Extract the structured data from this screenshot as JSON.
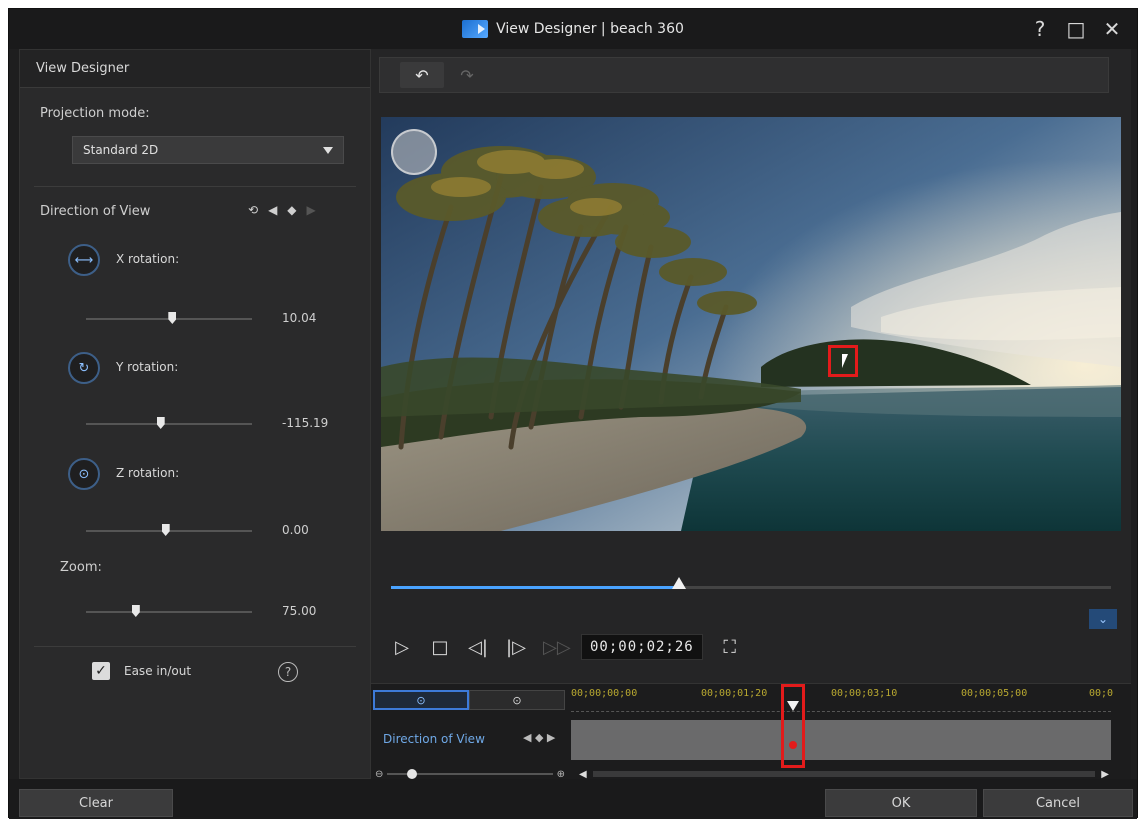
{
  "window": {
    "title": "View Designer | beach 360",
    "help": "?",
    "maximize": "□",
    "close": "✕"
  },
  "left_panel": {
    "header": "View Designer",
    "projection_label": "Projection mode:",
    "projection_value": "Standard 2D",
    "direction_label": "Direction of View",
    "x_rotation": {
      "label": "X rotation:",
      "value": "10.04",
      "level": 0.52
    },
    "y_rotation": {
      "label": "Y rotation:",
      "value": "-115.19",
      "level": 0.45
    },
    "z_rotation": {
      "label": "Z rotation:",
      "value": "0.00",
      "level": 0.48
    },
    "zoom": {
      "label": "Zoom:",
      "value": "75.00",
      "level": 0.3
    },
    "ease_label": "Ease in/out",
    "ease_checked": true
  },
  "toolbar": {
    "undo": "↶",
    "redo": "↷"
  },
  "playback": {
    "timecode": "00;00;02;26",
    "progress": 0.4
  },
  "timeline": {
    "track_label": "Direction of View",
    "ruler": [
      "00;00;00;00",
      "00;00;01;20",
      "00;00;03;10",
      "00;00;05;00",
      "00;0"
    ]
  },
  "buttons": {
    "clear": "Clear",
    "ok": "OK",
    "cancel": "Cancel"
  }
}
